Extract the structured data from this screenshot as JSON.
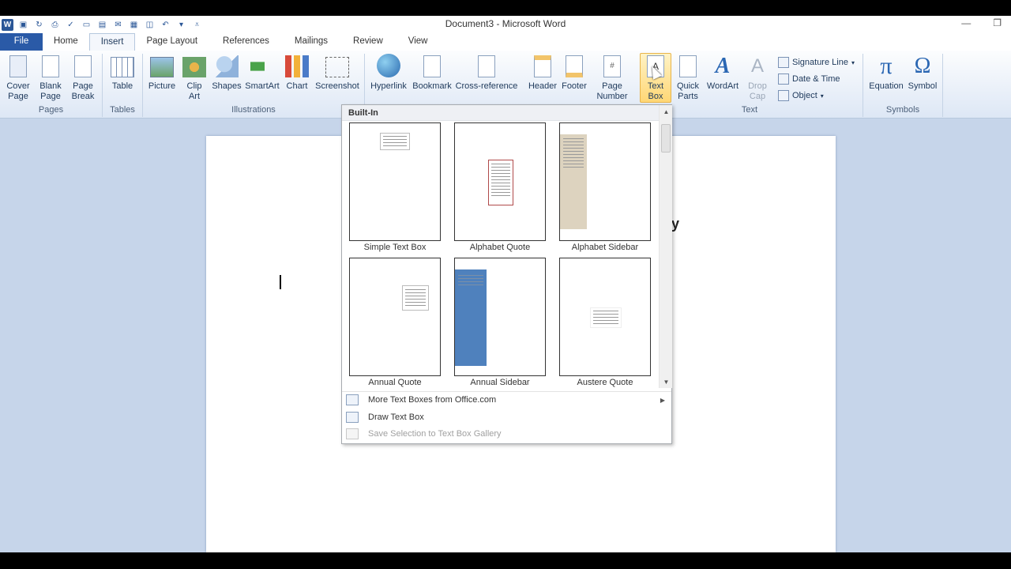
{
  "window": {
    "title": "Document3 - Microsoft Word",
    "minimize": "—",
    "restore": "❐"
  },
  "qat": {
    "word_icon": "W",
    "save_icon": "save-icon",
    "undo_icon": "undo-icon"
  },
  "tabs": [
    {
      "label": "File"
    },
    {
      "label": "Home"
    },
    {
      "label": "Insert"
    },
    {
      "label": "Page Layout"
    },
    {
      "label": "References"
    },
    {
      "label": "Mailings"
    },
    {
      "label": "Review"
    },
    {
      "label": "View"
    }
  ],
  "ribbon": {
    "pages": {
      "label": "Pages",
      "cover_page": "Cover\nPage",
      "blank_page": "Blank\nPage",
      "page_break": "Page\nBreak"
    },
    "tables": {
      "label": "Tables",
      "table": "Table"
    },
    "illustrations": {
      "label": "Illustrations",
      "picture": "Picture",
      "clip_art": "Clip\nArt",
      "shapes": "Shapes",
      "smartart": "SmartArt",
      "chart": "Chart",
      "screenshot": "Screenshot"
    },
    "links": {
      "hyperlink": "Hyperlink",
      "bookmark": "Bookmark",
      "cross_reference": "Cross-reference"
    },
    "header_footer": {
      "header": "Header",
      "footer": "Footer",
      "page_number": "Page\nNumber"
    },
    "text": {
      "label": "Text",
      "text_box": "Text\nBox",
      "quick_parts": "Quick\nParts",
      "wordart": "WordArt",
      "drop_cap": "Drop\nCap",
      "signature_line": "Signature Line",
      "date_time": "Date & Time",
      "object": "Object"
    },
    "symbols": {
      "label": "Symbols",
      "equation": "Equation",
      "symbol": "Symbol"
    }
  },
  "dropdown": {
    "section": "Built-In",
    "items": [
      {
        "label": "Simple Text Box"
      },
      {
        "label": "Alphabet Quote"
      },
      {
        "label": "Alphabet Sidebar"
      },
      {
        "label": "Annual Quote"
      },
      {
        "label": "Annual Sidebar"
      },
      {
        "label": "Austere Quote"
      }
    ],
    "menu": {
      "more": "More Text Boxes from Office.com",
      "draw": "Draw Text Box",
      "save": "Save Selection to Text Box Gallery"
    }
  },
  "document": {
    "stray_char": "y"
  },
  "colors": {
    "file_tab": "#2a5aa7",
    "ribbon_bg": "#dde7f5",
    "canvas": "#c6d5ea",
    "highlight": "#ffd775",
    "sidebar_blue": "#4f81bd"
  }
}
